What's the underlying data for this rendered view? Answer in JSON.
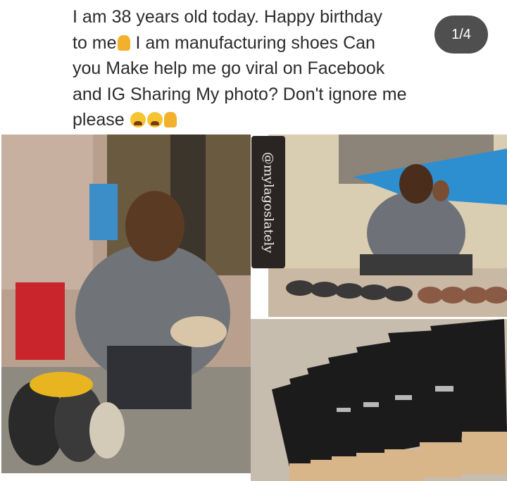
{
  "post": {
    "caption_lines": [
      "I am 38 years old today. Happy birthday",
      "to me",
      " I am  manufacturing shoes Can",
      "you Make help me go viral on Facebook",
      "and IG Sharing My photo?  Don't ignore me",
      "please"
    ],
    "carousel_counter": "1/4"
  },
  "watermark": {
    "handle": "@mylagoslately"
  },
  "icons": [
    "folded-hands-emoji",
    "crying-face-emoji"
  ]
}
